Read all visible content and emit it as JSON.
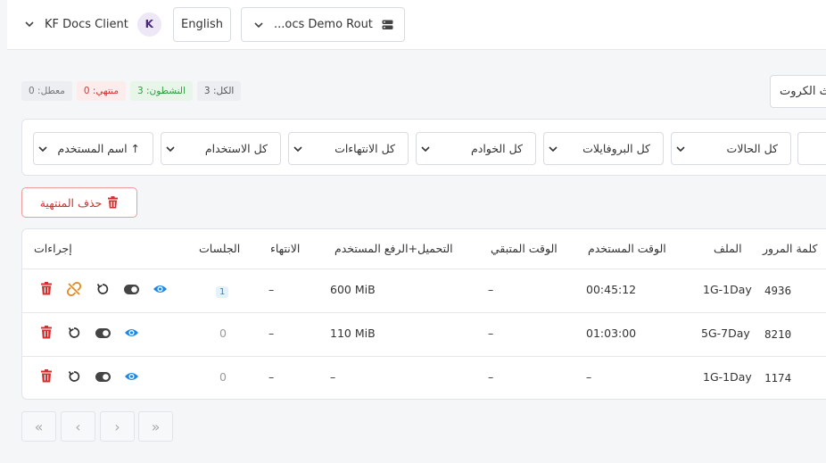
{
  "topbar": {
    "client_name": "KF Docs Client",
    "client_avatar": "K",
    "language": "English",
    "router_name": "...ocs Demo Router"
  },
  "search": {
    "cards_label": "ث الكروت"
  },
  "badges": {
    "disabled": "معطل: 0",
    "expired": "منتهي: 0",
    "active": "النشطون: 3",
    "all": "الكل: 3"
  },
  "filters": {
    "status": "كل الحالات",
    "profiles": "كل البروفايلات",
    "servers": "كل الخوادم",
    "expirations": "كل الانتهاءات",
    "usage": "كل الاستخدام",
    "sort": "اسم المستخدم ↑"
  },
  "actions": {
    "delete_expired": "حذف المنتهية"
  },
  "table": {
    "headers": {
      "password": "كلمة المرور",
      "profile": "الملف",
      "time_used": "الوقت المستخدم",
      "time_left": "الوقت المتبقي",
      "data_used": "التحميل+الرفع المستخدم",
      "expiry": "الانتهاء",
      "sessions": "الجلسات",
      "actions": "إجراءات"
    },
    "rows": [
      {
        "password": "4936",
        "profile": "1G-1Day",
        "time_used": "00:45:12",
        "time_left": "–",
        "data_used": "600 MiB",
        "expiry": "–",
        "sessions": "1"
      },
      {
        "password": "8210",
        "profile": "5G-7Day",
        "time_used": "01:03:00",
        "time_left": "–",
        "data_used": "110 MiB",
        "expiry": "–",
        "sessions": "0"
      },
      {
        "password": "1174",
        "profile": "1G-1Day",
        "time_used": "–",
        "time_left": "–",
        "data_used": "–",
        "expiry": "–",
        "sessions": "0"
      }
    ]
  },
  "pagination": {
    "first": "«",
    "prev": "‹",
    "next": "›",
    "last": "»"
  },
  "colors": {
    "danger": "#d32f2f",
    "active_green": "#2e9b43",
    "view_blue": "#1e88e5",
    "unlink_orange": "#e08a2c"
  }
}
